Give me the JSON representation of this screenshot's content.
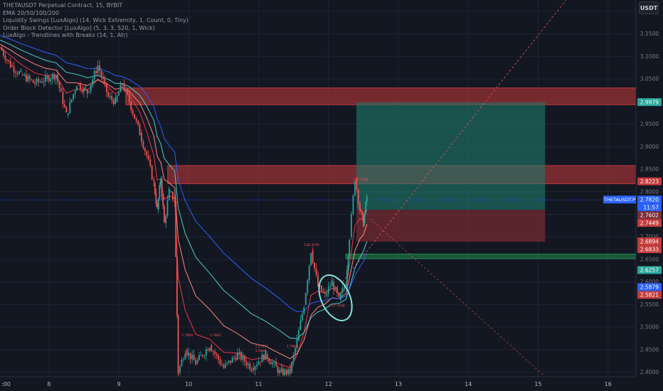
{
  "legend": {
    "symbol_line": "THETAUSDT Perpetual Contract, 15, BYBIT",
    "ema_line": "EMA 20/50/100/200",
    "swings_line": "Liquidity Swings [LuxAlgo] (14, Wick Extremity, 1, Count, 0, Tiny)",
    "ob_line": "Order Block Detector [LuxAlgo] (5, 3, 3, 520, 1, Wick)",
    "trend_line": "LuxAlgo - Trendlines with Breaks (14, 1, Atr)"
  },
  "currency_button": "USDT",
  "colors": {
    "background": "#131722",
    "grid": "#1f2330",
    "candle_up": "#26a69a",
    "candle_down": "#ef5350",
    "ema_fast": "#f23645",
    "ema_mid": "#ff8a80",
    "ema_slow": "#4dd0c8",
    "ema_long": "#2962ff",
    "zone_red": "#c43b3b",
    "zone_green": "#1e8c4c",
    "target_teal": "#1f7a6d",
    "stop_red": "#8c2e35",
    "circle": "#7fe3dc"
  },
  "chart_data": {
    "type": "candlestick",
    "symbol": "THETAUSDT.P",
    "timeframe": "15",
    "x_ticks": [
      "8",
      "9",
      "10",
      "11",
      "12",
      "13",
      "14",
      "15",
      "16"
    ],
    "x_tick_first_partial": ":00",
    "y_ticks": [
      "3.2000",
      "3.1500",
      "3.1000",
      "3.0500",
      "3.0000",
      "2.9500",
      "2.9000",
      "2.8500",
      "2.8000",
      "2.7500",
      "2.7000",
      "2.6500",
      "2.6000",
      "2.5500",
      "2.5000",
      "2.4500",
      "2.4000"
    ],
    "y_ticks_values": [
      3.2,
      3.15,
      3.1,
      3.05,
      3.0,
      2.95,
      2.9,
      2.85,
      2.8,
      2.75,
      2.7,
      2.65,
      2.6,
      2.55,
      2.5,
      2.45,
      2.4
    ],
    "ylim": [
      2.39,
      3.225
    ],
    "xlim_days": [
      7.3,
      16.4
    ],
    "price_path": [
      [
        7.3,
        3.12
      ],
      [
        7.45,
        3.08
      ],
      [
        7.6,
        3.06
      ],
      [
        7.8,
        3.04
      ],
      [
        7.95,
        3.05
      ],
      [
        8.1,
        3.06
      ],
      [
        8.25,
        2.97
      ],
      [
        8.4,
        3.04
      ],
      [
        8.55,
        3.02
      ],
      [
        8.7,
        3.08
      ],
      [
        8.85,
        3.01
      ],
      [
        8.95,
        3.0
      ],
      [
        9.05,
        3.04
      ],
      [
        9.15,
        3.0
      ],
      [
        9.3,
        2.93
      ],
      [
        9.4,
        2.88
      ],
      [
        9.5,
        2.82
      ],
      [
        9.55,
        2.76
      ],
      [
        9.6,
        2.83
      ],
      [
        9.65,
        2.73
      ],
      [
        9.72,
        2.8
      ],
      [
        9.8,
        2.78
      ],
      [
        9.85,
        2.4
      ],
      [
        9.95,
        2.45
      ],
      [
        10.1,
        2.42
      ],
      [
        10.3,
        2.46
      ],
      [
        10.5,
        2.41
      ],
      [
        10.7,
        2.44
      ],
      [
        10.9,
        2.41
      ],
      [
        11.1,
        2.44
      ],
      [
        11.3,
        2.4
      ],
      [
        11.45,
        2.4
      ],
      [
        11.55,
        2.47
      ],
      [
        11.65,
        2.55
      ],
      [
        11.75,
        2.67
      ],
      [
        11.85,
        2.59
      ],
      [
        11.95,
        2.57
      ],
      [
        12.05,
        2.6
      ],
      [
        12.15,
        2.56
      ],
      [
        12.25,
        2.6
      ],
      [
        12.3,
        2.7
      ],
      [
        12.38,
        2.83
      ],
      [
        12.45,
        2.76
      ],
      [
        12.5,
        2.73
      ],
      [
        12.55,
        2.79
      ]
    ],
    "price_labels": [
      {
        "text": "2.9979",
        "value": 2.9979,
        "color": "#2aa69a"
      },
      {
        "text": "2.8223",
        "value": 2.8223,
        "color": "#c43b3b"
      },
      {
        "text": "THETAUSDT.P",
        "value": 2.782,
        "color": "#2962ff"
      },
      {
        "text": "2.7820",
        "value": 2.782,
        "color": "#2962ff"
      },
      {
        "text": "11:57",
        "value": 2.782,
        "color": "#2962ff"
      },
      {
        "text": "2.7602",
        "value": 2.7602,
        "color": "#7a2e38"
      },
      {
        "text": "2.7449",
        "value": 2.7449,
        "color": "#c43b3b"
      },
      {
        "text": "2.6894",
        "value": 2.6894,
        "color": "#c43b3b"
      },
      {
        "text": "2.6833",
        "value": 2.6833,
        "color": "#c43b3b"
      },
      {
        "text": "2.6257",
        "value": 2.6257,
        "color": "#2aa69a"
      },
      {
        "text": "2.5879",
        "value": 2.5879,
        "color": "#2962ff"
      },
      {
        "text": "2.5821",
        "value": 2.5821,
        "color": "#c43b3b"
      }
    ],
    "zones": [
      {
        "kind": "supply",
        "top": 3.03,
        "bottom": 2.993,
        "x0": 9.1,
        "x1": 16.4
      },
      {
        "kind": "supply",
        "top": 2.858,
        "bottom": 2.818,
        "x0": 9.7,
        "x1": 16.4
      },
      {
        "kind": "demand",
        "top": 2.662,
        "bottom": 2.652,
        "x0": 12.25,
        "x1": 16.4
      }
    ],
    "position": {
      "entry": 2.7602,
      "target": 2.9979,
      "stop": 2.6894,
      "x0": 12.4,
      "x1": 15.1
    },
    "annotations": [
      "1.7869",
      "1.7863",
      "1.0996",
      "1.37391",
      "1.7866",
      "136.3076",
      "1.57.7488",
      "157.7486"
    ]
  }
}
